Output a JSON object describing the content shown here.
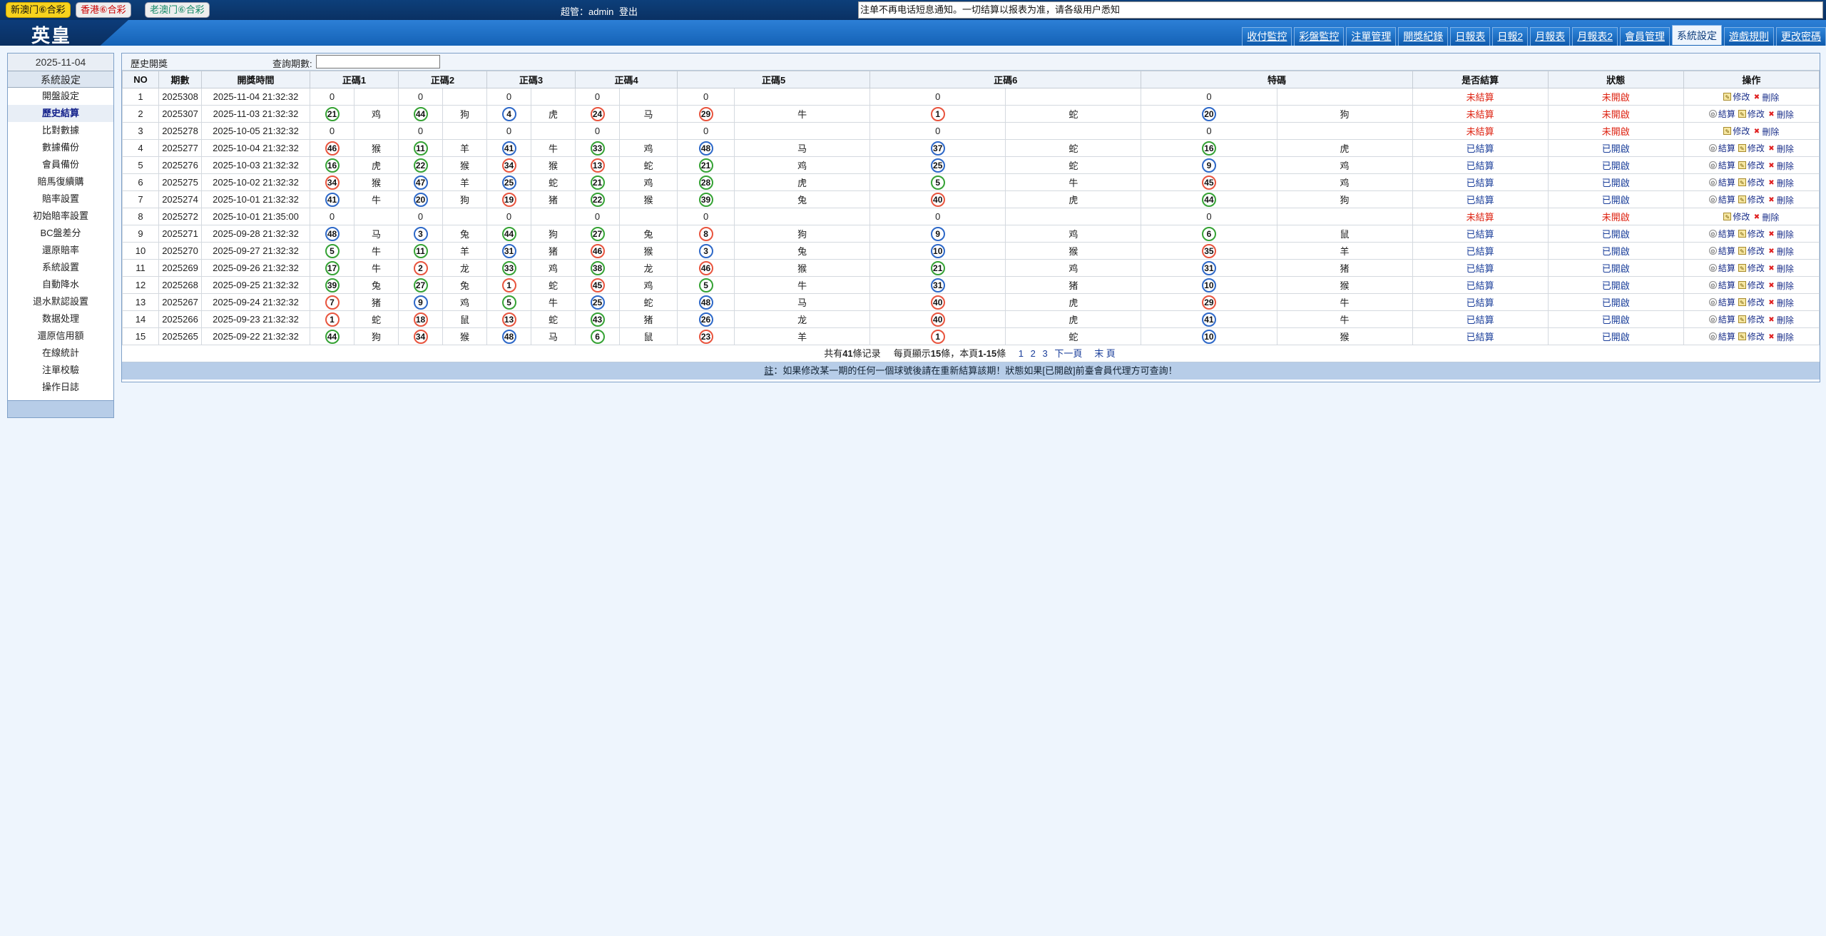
{
  "topbar": {
    "lotteries": [
      "新澳门⑥合彩",
      "香港⑥合彩",
      "老澳门⑥合彩"
    ],
    "user_label": "超管：admin",
    "logout": "登出",
    "notice": "注单不再电话短息通知。一切结算以报表为准，请各级用户悉知"
  },
  "header": {
    "logo": "英皇",
    "nav": [
      "收付監控",
      "彩盤監控",
      "注單管理",
      "開獎紀錄",
      "日報表",
      "日報2",
      "月報表",
      "月報表2",
      "會員管理",
      "系統設定",
      "遊戲規則",
      "更改密碼"
    ],
    "active_nav": "系統設定"
  },
  "sidebar": {
    "date": "2025-11-04",
    "title": "系統設定",
    "items": [
      "開盤設定",
      "歷史結算",
      "比對數據",
      "數據備份",
      "會員備份",
      "賠馬復續購",
      "賠率設置",
      "初始賠率設置",
      "BC盤差分",
      "還原賠率",
      "系統設置",
      "自動降水",
      "退水默認設置",
      "数据处理",
      "還原信用額",
      "在線統計",
      "注單校驗",
      "操作日誌"
    ],
    "active": "歷史結算"
  },
  "main": {
    "title": "歷史開獎",
    "query_label": "查詢期數:",
    "columns": [
      "NO",
      "期數",
      "開獎時間",
      "正碼1",
      "正碼2",
      "正碼3",
      "正碼4",
      "正碼5",
      "正碼6",
      "特碼",
      "是否結算",
      "狀態",
      "操作"
    ],
    "rows": [
      {
        "no": "1",
        "issue": "2025308",
        "time": "2025-11-04 21:32:32",
        "balls": [
          [
            "0",
            ""
          ],
          [
            "0",
            ""
          ],
          [
            "0",
            ""
          ],
          [
            "0",
            ""
          ],
          [
            "0",
            ""
          ],
          [
            "0",
            ""
          ],
          [
            "0",
            ""
          ]
        ],
        "settled": "未結算",
        "status": "未開啟",
        "ops": [
          "修改",
          "刪除"
        ]
      },
      {
        "no": "2",
        "issue": "2025307",
        "time": "2025-11-03 21:32:32",
        "balls": [
          [
            "21",
            "鸡"
          ],
          [
            "44",
            "狗"
          ],
          [
            "4",
            "虎"
          ],
          [
            "24",
            "马"
          ],
          [
            "29",
            "牛"
          ],
          [
            "1",
            "蛇"
          ],
          [
            "20",
            "狗"
          ]
        ],
        "settled": "未結算",
        "status": "未開啟",
        "ops": [
          "結算",
          "修改",
          "刪除"
        ]
      },
      {
        "no": "3",
        "issue": "2025278",
        "time": "2025-10-05 21:32:32",
        "balls": [
          [
            "0",
            ""
          ],
          [
            "0",
            ""
          ],
          [
            "0",
            ""
          ],
          [
            "0",
            ""
          ],
          [
            "0",
            ""
          ],
          [
            "0",
            ""
          ],
          [
            "0",
            ""
          ]
        ],
        "settled": "未結算",
        "status": "未開啟",
        "ops": [
          "修改",
          "刪除"
        ]
      },
      {
        "no": "4",
        "issue": "2025277",
        "time": "2025-10-04 21:32:32",
        "balls": [
          [
            "46",
            "猴"
          ],
          [
            "11",
            "羊"
          ],
          [
            "41",
            "牛"
          ],
          [
            "33",
            "鸡"
          ],
          [
            "48",
            "马"
          ],
          [
            "37",
            "蛇"
          ],
          [
            "16",
            "虎"
          ]
        ],
        "settled": "已結算",
        "status": "已開啟",
        "ops": [
          "結算",
          "修改",
          "刪除"
        ]
      },
      {
        "no": "5",
        "issue": "2025276",
        "time": "2025-10-03 21:32:32",
        "balls": [
          [
            "16",
            "虎"
          ],
          [
            "22",
            "猴"
          ],
          [
            "34",
            "猴"
          ],
          [
            "13",
            "蛇"
          ],
          [
            "21",
            "鸡"
          ],
          [
            "25",
            "蛇"
          ],
          [
            "9",
            "鸡"
          ]
        ],
        "settled": "已結算",
        "status": "已開啟",
        "ops": [
          "結算",
          "修改",
          "刪除"
        ]
      },
      {
        "no": "6",
        "issue": "2025275",
        "time": "2025-10-02 21:32:32",
        "balls": [
          [
            "34",
            "猴"
          ],
          [
            "47",
            "羊"
          ],
          [
            "25",
            "蛇"
          ],
          [
            "21",
            "鸡"
          ],
          [
            "28",
            "虎"
          ],
          [
            "5",
            "牛"
          ],
          [
            "45",
            "鸡"
          ]
        ],
        "settled": "已結算",
        "status": "已開啟",
        "ops": [
          "結算",
          "修改",
          "刪除"
        ]
      },
      {
        "no": "7",
        "issue": "2025274",
        "time": "2025-10-01 21:32:32",
        "balls": [
          [
            "41",
            "牛"
          ],
          [
            "20",
            "狗"
          ],
          [
            "19",
            "猪"
          ],
          [
            "22",
            "猴"
          ],
          [
            "39",
            "兔"
          ],
          [
            "40",
            "虎"
          ],
          [
            "44",
            "狗"
          ]
        ],
        "settled": "已結算",
        "status": "已開啟",
        "ops": [
          "結算",
          "修改",
          "刪除"
        ]
      },
      {
        "no": "8",
        "issue": "2025272",
        "time": "2025-10-01 21:35:00",
        "balls": [
          [
            "0",
            ""
          ],
          [
            "0",
            ""
          ],
          [
            "0",
            ""
          ],
          [
            "0",
            ""
          ],
          [
            "0",
            ""
          ],
          [
            "0",
            ""
          ],
          [
            "0",
            ""
          ]
        ],
        "settled": "未結算",
        "status": "未開啟",
        "ops": [
          "修改",
          "刪除"
        ]
      },
      {
        "no": "9",
        "issue": "2025271",
        "time": "2025-09-28 21:32:32",
        "balls": [
          [
            "48",
            "马"
          ],
          [
            "3",
            "兔"
          ],
          [
            "44",
            "狗"
          ],
          [
            "27",
            "兔"
          ],
          [
            "8",
            "狗"
          ],
          [
            "9",
            "鸡"
          ],
          [
            "6",
            "鼠"
          ]
        ],
        "settled": "已結算",
        "status": "已開啟",
        "ops": [
          "結算",
          "修改",
          "刪除"
        ]
      },
      {
        "no": "10",
        "issue": "2025270",
        "time": "2025-09-27 21:32:32",
        "balls": [
          [
            "5",
            "牛"
          ],
          [
            "11",
            "羊"
          ],
          [
            "31",
            "猪"
          ],
          [
            "46",
            "猴"
          ],
          [
            "3",
            "兔"
          ],
          [
            "10",
            "猴"
          ],
          [
            "35",
            "羊"
          ]
        ],
        "settled": "已結算",
        "status": "已開啟",
        "ops": [
          "結算",
          "修改",
          "刪除"
        ]
      },
      {
        "no": "11",
        "issue": "2025269",
        "time": "2025-09-26 21:32:32",
        "balls": [
          [
            "17",
            "牛"
          ],
          [
            "2",
            "龙"
          ],
          [
            "33",
            "鸡"
          ],
          [
            "38",
            "龙"
          ],
          [
            "46",
            "猴"
          ],
          [
            "21",
            "鸡"
          ],
          [
            "31",
            "猪"
          ]
        ],
        "settled": "已結算",
        "status": "已開啟",
        "ops": [
          "結算",
          "修改",
          "刪除"
        ]
      },
      {
        "no": "12",
        "issue": "2025268",
        "time": "2025-09-25 21:32:32",
        "balls": [
          [
            "39",
            "兔"
          ],
          [
            "27",
            "兔"
          ],
          [
            "1",
            "蛇"
          ],
          [
            "45",
            "鸡"
          ],
          [
            "5",
            "牛"
          ],
          [
            "31",
            "猪"
          ],
          [
            "10",
            "猴"
          ]
        ],
        "settled": "已結算",
        "status": "已開啟",
        "ops": [
          "結算",
          "修改",
          "刪除"
        ]
      },
      {
        "no": "13",
        "issue": "2025267",
        "time": "2025-09-24 21:32:32",
        "balls": [
          [
            "7",
            "猪"
          ],
          [
            "9",
            "鸡"
          ],
          [
            "5",
            "牛"
          ],
          [
            "25",
            "蛇"
          ],
          [
            "48",
            "马"
          ],
          [
            "40",
            "虎"
          ],
          [
            "29",
            "牛"
          ]
        ],
        "settled": "已結算",
        "status": "已開啟",
        "ops": [
          "結算",
          "修改",
          "刪除"
        ]
      },
      {
        "no": "14",
        "issue": "2025266",
        "time": "2025-09-23 21:32:32",
        "balls": [
          [
            "1",
            "蛇"
          ],
          [
            "18",
            "鼠"
          ],
          [
            "13",
            "蛇"
          ],
          [
            "43",
            "猪"
          ],
          [
            "26",
            "龙"
          ],
          [
            "40",
            "虎"
          ],
          [
            "41",
            "牛"
          ]
        ],
        "settled": "已結算",
        "status": "已開啟",
        "ops": [
          "結算",
          "修改",
          "刪除"
        ]
      },
      {
        "no": "15",
        "issue": "2025265",
        "time": "2025-09-22 21:32:32",
        "balls": [
          [
            "44",
            "狗"
          ],
          [
            "34",
            "猴"
          ],
          [
            "48",
            "马"
          ],
          [
            "6",
            "鼠"
          ],
          [
            "23",
            "羊"
          ],
          [
            "1",
            "蛇"
          ],
          [
            "10",
            "猴"
          ]
        ],
        "settled": "已結算",
        "status": "已開啟",
        "ops": [
          "結算",
          "修改",
          "刪除"
        ]
      }
    ],
    "pager": {
      "total_prefix": "共有",
      "total": "41",
      "total_suffix": "條记录",
      "per_page_prefix": "每頁顯示",
      "per_page": "15",
      "per_page_suffix": "條，本頁",
      "range": "1-15",
      "range_suffix": "條",
      "pages": [
        "1",
        "2",
        "3"
      ],
      "next": "下一頁",
      "last": "末 頁"
    },
    "footnote_prefix": "註",
    "footnote": "：如果修改某一期的任何一個球號後請在重新結算該期！狀態如果[已開啟]前臺會員代理方可查詢！"
  }
}
